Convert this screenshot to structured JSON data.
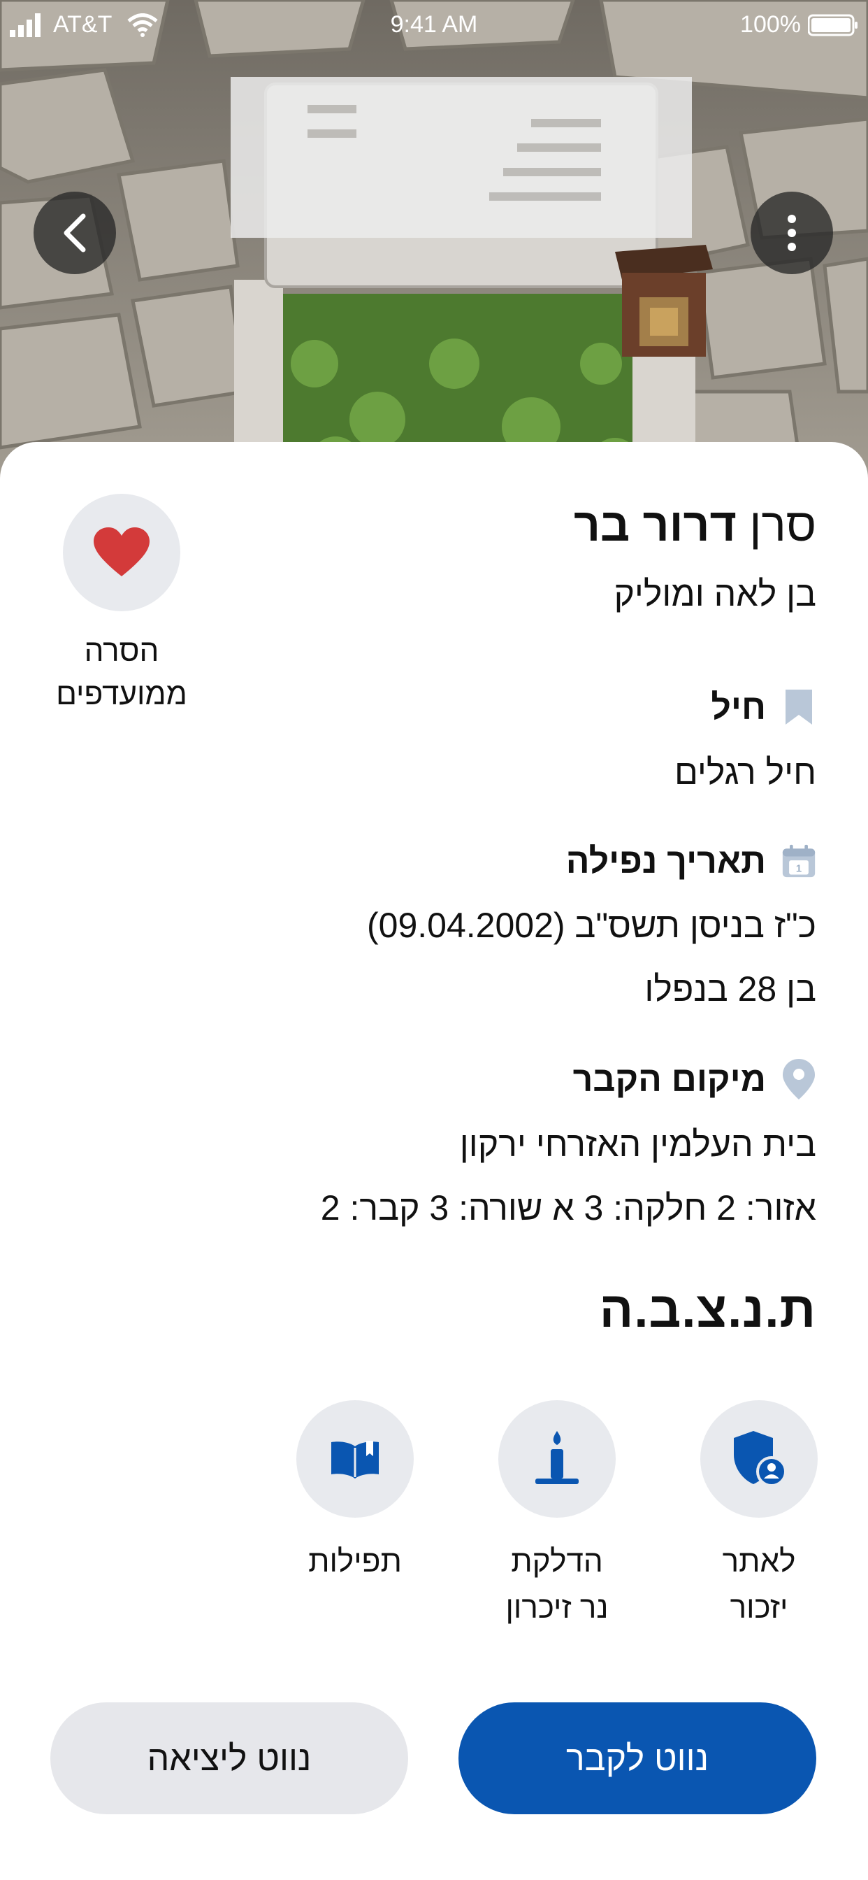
{
  "status_bar": {
    "carrier": "AT&T",
    "time": "9:41 AM",
    "battery": "100%"
  },
  "nav": {
    "back_icon": "chevron-left-icon",
    "more_icon": "more-vertical-icon"
  },
  "profile": {
    "rank": "סרן",
    "name": "דרור בר",
    "parents": "בן לאה ומוליק",
    "favorite": {
      "label_line1": "הסרה",
      "label_line2": "ממועדפים",
      "icon": "heart-icon",
      "color": "#d33a3a"
    }
  },
  "sections": {
    "corps": {
      "title": "חיל",
      "value": "חיל רגלים"
    },
    "date": {
      "title": "תאריך נפילה",
      "hebrew_date": "כ\"ז בניסן תשס\"ב (09.04.2002)",
      "age": "בן 28 בנפלו"
    },
    "location": {
      "title": "מיקום הקבר",
      "cemetery": "בית העלמין האזרחי ירקון",
      "plot": "אזור: 2 חלקה: 3 א שורה: 3 קבר: 2"
    }
  },
  "initials": "ת.נ.צ.ב.ה",
  "actions": [
    {
      "line1": "לאתר",
      "line2": "יזכור",
      "icon": "shield-person-icon"
    },
    {
      "line1": "הדלקת",
      "line2": "נר זיכרון",
      "icon": "candle-icon"
    },
    {
      "line1": "תפילות",
      "line2": "",
      "icon": "open-book-icon"
    }
  ],
  "buttons": {
    "primary": "נווט לקבר",
    "secondary": "נווט ליציאה"
  },
  "colors": {
    "primary": "#0a56b1",
    "icon_gray": "#b9c7d8",
    "circle_bg": "#e8eaee"
  }
}
